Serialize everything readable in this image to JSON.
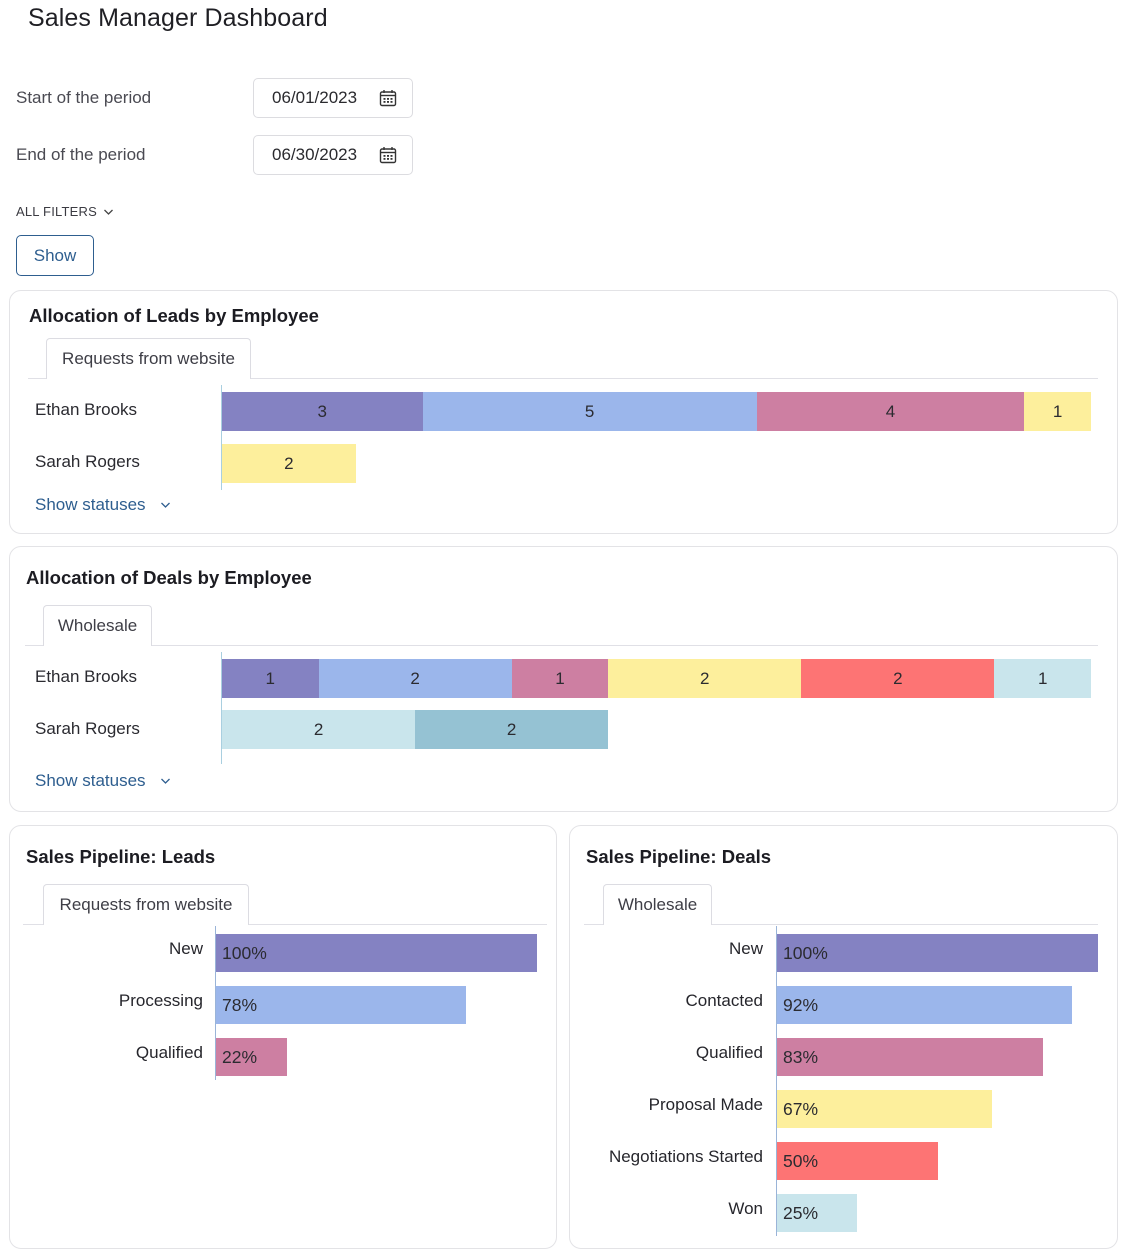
{
  "page": {
    "title": "Sales Manager Dashboard"
  },
  "filters": {
    "start": {
      "label": "Start of the period",
      "value": "06/01/2023",
      "icon": "calendar-icon"
    },
    "end": {
      "label": "End of the period",
      "value": "06/30/2023",
      "icon": "calendar-icon"
    },
    "all_filters_label": "ALL FILTERS",
    "show_button": "Show"
  },
  "colors": {
    "purple": "#8482c2",
    "light_blue": "#9bb6eb",
    "pink": "#cd7fa2",
    "yellow": "#fdef9c",
    "red": "#fd7474",
    "pale_cyan": "#c9e5ec",
    "steel_blue": "#95c2d3",
    "link": "#2e5e8f"
  },
  "chart_data": [
    {
      "id": "leads-allocation",
      "type": "bar",
      "orientation": "horizontal-stacked",
      "title": "Allocation of Leads by Employee",
      "tab": "Requests from website",
      "categories": [
        "Ethan Brooks",
        "Sarah Rogers"
      ],
      "rows": [
        {
          "name": "Ethan Brooks",
          "segments": [
            {
              "value": 3,
              "color": "#8482c2"
            },
            {
              "value": 5,
              "color": "#9bb6eb"
            },
            {
              "value": 4,
              "color": "#cd7fa2"
            },
            {
              "value": 1,
              "color": "#fdef9c"
            }
          ]
        },
        {
          "name": "Sarah Rogers",
          "segments": [
            {
              "value": 2,
              "color": "#fdef9c"
            }
          ]
        }
      ],
      "scale_max": 13,
      "footer_link": "Show statuses"
    },
    {
      "id": "deals-allocation",
      "type": "bar",
      "orientation": "horizontal-stacked",
      "title": "Allocation of Deals by Employee",
      "tab": "Wholesale",
      "categories": [
        "Ethan Brooks",
        "Sarah Rogers"
      ],
      "rows": [
        {
          "name": "Ethan Brooks",
          "segments": [
            {
              "value": 1,
              "color": "#8482c2"
            },
            {
              "value": 2,
              "color": "#9bb6eb"
            },
            {
              "value": 1,
              "color": "#cd7fa2"
            },
            {
              "value": 2,
              "color": "#fdef9c"
            },
            {
              "value": 2,
              "color": "#fd7474"
            },
            {
              "value": 1,
              "color": "#c9e5ec"
            }
          ]
        },
        {
          "name": "Sarah Rogers",
          "segments": [
            {
              "value": 2,
              "color": "#c9e5ec"
            },
            {
              "value": 2,
              "color": "#95c2d3"
            }
          ]
        }
      ],
      "scale_max": 9,
      "footer_link": "Show statuses"
    },
    {
      "id": "pipeline-leads",
      "type": "bar",
      "orientation": "horizontal",
      "title": "Sales Pipeline: Leads",
      "tab": "Requests from website",
      "categories": [
        "New",
        "Processing",
        "Qualified"
      ],
      "values": [
        100,
        78,
        22
      ],
      "labels": [
        "100%",
        "78%",
        "22%"
      ],
      "colors": [
        "#8482c2",
        "#9bb6eb",
        "#cd7fa2"
      ],
      "xlim": [
        0,
        100
      ]
    },
    {
      "id": "pipeline-deals",
      "type": "bar",
      "orientation": "horizontal",
      "title": "Sales Pipeline: Deals",
      "tab": "Wholesale",
      "categories": [
        "New",
        "Contacted",
        "Qualified",
        "Proposal Made",
        "Negotiations Started",
        "Won"
      ],
      "values": [
        100,
        92,
        83,
        67,
        50,
        25
      ],
      "labels": [
        "100%",
        "92%",
        "83%",
        "67%",
        "50%",
        "25%"
      ],
      "colors": [
        "#8482c2",
        "#9bb6eb",
        "#cd7fa2",
        "#fdef9c",
        "#fd7474",
        "#c9e5ec"
      ],
      "xlim": [
        0,
        100
      ]
    }
  ]
}
